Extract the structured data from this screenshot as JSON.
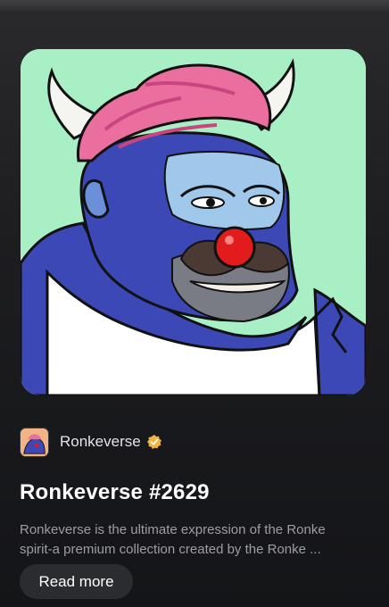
{
  "nft": {
    "collection_name": "Ronkeverse",
    "title": "Ronkeverse #2629",
    "description_line1": "Ronkeverse is the ultimate expression of the Ronke",
    "description_line2": "spirit-a premium collection created by the Ronke ...",
    "read_more_label": "Read more",
    "verified_icon": "verified-check-icon"
  },
  "colors": {
    "artwork_background": "#a9efc5",
    "verified_badge": "#f2b33d",
    "avatar_background": "#f2b487",
    "button_background": "#2b2c30",
    "description_text": "#9d9da3"
  }
}
